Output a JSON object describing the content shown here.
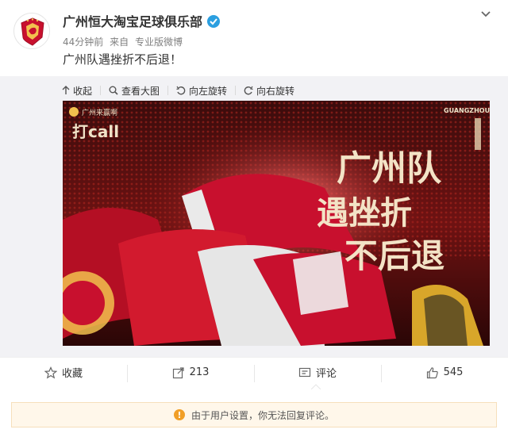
{
  "post": {
    "author": "广州恒大淘宝足球俱乐部",
    "time": "44分钟前",
    "source_prefix": "来自",
    "source": "专业版微博",
    "text": "广州队遇挫折不后退！"
  },
  "media_toolbar": {
    "collapse": "收起",
    "view_large": "查看大图",
    "rotate_left": "向左旋转",
    "rotate_right": "向右旋转"
  },
  "image": {
    "badge_title": "广州来赢啊",
    "badge_sub": "打call",
    "corner_text": "GUANGZHOU",
    "calligraphy_line1": "广州队",
    "calligraphy_line2": "遇挫折",
    "calligraphy_line3": "不后退"
  },
  "actions": {
    "favorite": "收藏",
    "repost_count": "213",
    "comment": "评论",
    "like_count": "545"
  },
  "notice": {
    "text": "由于用户设置，你无法回复评论。"
  },
  "colors": {
    "accent_blue": "#2b9fe0",
    "notice_bg": "#fff7ea",
    "warn_orange": "#f19f27",
    "photo_red": "#c8102e"
  }
}
